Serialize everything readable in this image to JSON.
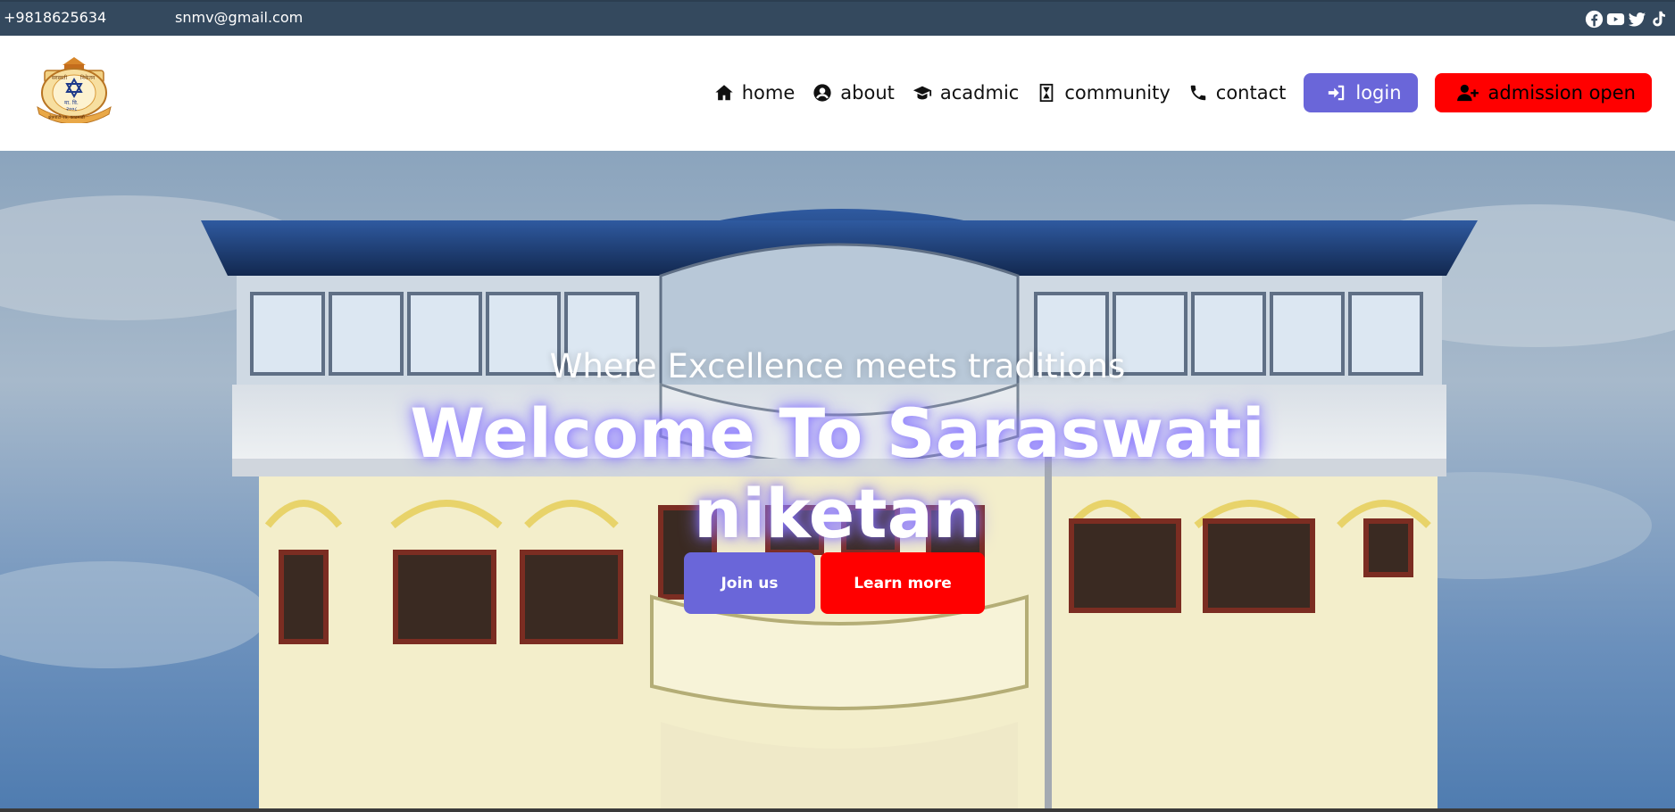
{
  "topbar": {
    "phone": "+9818625634",
    "email": "snmv@gmail.com",
    "phone_icon": "phone-icon",
    "email_icon": "envelope-icon",
    "socials": [
      "facebook-icon",
      "youtube-icon",
      "twitter-icon",
      "tiktok-icon"
    ]
  },
  "logo": {
    "top_left": "सरस्वती",
    "top_right": "निकेतन",
    "mid": "मा. वि.",
    "year": "२००८",
    "bottom": "क्षेत्रपाटी-१७, काठमाडौं"
  },
  "nav": {
    "items": [
      {
        "label": "home",
        "icon": "home-icon"
      },
      {
        "label": "about",
        "icon": "user-circle-icon"
      },
      {
        "label": "acadmic",
        "icon": "graduation-cap-icon"
      },
      {
        "label": "community",
        "icon": "hourglass-icon"
      },
      {
        "label": "contact",
        "icon": "phone-icon"
      }
    ],
    "login": "login",
    "admission": "admission open"
  },
  "hero": {
    "tagline": "Where Excellence meets traditions",
    "headline_line1": "Welcome To Saraswati",
    "headline_line2": "niketan",
    "join": "Join us",
    "learn": "Learn more"
  },
  "colors": {
    "topbar": "#34495e",
    "accent_purple": "#6a66d9",
    "accent_red": "#ff0000"
  }
}
